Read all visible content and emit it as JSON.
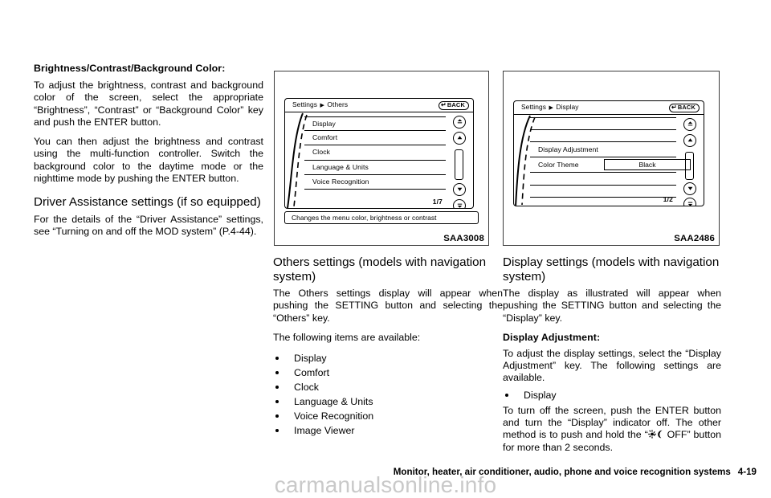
{
  "left_column": {
    "heading_bold": "Brightness/Contrast/Background Color:",
    "para_1": "To adjust the brightness, contrast and background color of the screen, select the appropriate “Brightness”, “Contrast” or “Background Color” key and push the ENTER button.",
    "para_2": "You can then adjust the brightness and contrast using the multi-function controller. Switch the background color to the daytime mode or the nighttime mode by pushing the ENTER button.",
    "heading_section": "Driver Assistance settings (if so equipped)",
    "para_3": "For the details of the “Driver Assistance” settings, see “Turning on and off the MOD system” (P.4-44)."
  },
  "figure_1": {
    "code": "SAA3008",
    "breadcrumb_root": "Settings",
    "breadcrumb_arrow": "▶",
    "breadcrumb_leaf": "Others",
    "back_label": "BACK",
    "back_icon": "return-arrow-icon",
    "rows": [
      {
        "label": "Display"
      },
      {
        "label": "Comfort"
      },
      {
        "label": "Clock"
      },
      {
        "label": "Language & Units"
      },
      {
        "label": "Voice Recognition"
      }
    ],
    "page_indicator": "1/7",
    "status_text": "Changes the menu color, brightness or contrast",
    "scroll_buttons": [
      "double-up-arrow-icon",
      "up-arrow-icon",
      "down-arrow-icon",
      "double-down-arrow-icon"
    ]
  },
  "figure_2": {
    "code": "SAA2486",
    "breadcrumb_root": "Settings",
    "breadcrumb_arrow": "▶",
    "breadcrumb_leaf": "Display",
    "back_label": "BACK",
    "back_icon": "return-arrow-icon",
    "rows": [
      {
        "label": ""
      },
      {
        "label": ""
      },
      {
        "label": "Display Adjustment"
      },
      {
        "label": "Color Theme",
        "value": "Black"
      },
      {
        "label": ""
      },
      {
        "label": ""
      }
    ],
    "page_indicator": "1/2",
    "scroll_buttons": [
      "double-up-arrow-icon",
      "up-arrow-icon",
      "down-arrow-icon",
      "double-down-arrow-icon"
    ]
  },
  "mid_column": {
    "heading_section": "Others settings (models with navigation system)",
    "para_1": "The Others settings display will appear when pushing the SETTING button and selecting the “Others” key.",
    "para_2": "The following items are available:",
    "bullets": [
      "Display",
      "Comfort",
      "Clock",
      "Language & Units",
      "Voice Recognition",
      "Image Viewer"
    ]
  },
  "right_column": {
    "heading_section": "Display settings (models with navigation system)",
    "para_1": "The display as illustrated will appear when pushing the SETTING button and selecting the “Display” key.",
    "heading_bold": "Display Adjustment:",
    "para_2": "To adjust the display settings, select the “Display Adjustment” key. The following settings are available.",
    "bullet_1": "Display",
    "para_3_before": "To turn off the screen, push the ENTER button and turn the “Display” indicator off. The other method is to push and hold the “",
    "para_3_icon": "sun-moon-icon",
    "para_3_after": " OFF” button for more than 2 seconds."
  },
  "footer": {
    "chapter_title": "Monitor, heater, air conditioner, audio, phone and voice recognition systems",
    "page_number": "4-19",
    "watermark": "carmanualsonline.info"
  }
}
